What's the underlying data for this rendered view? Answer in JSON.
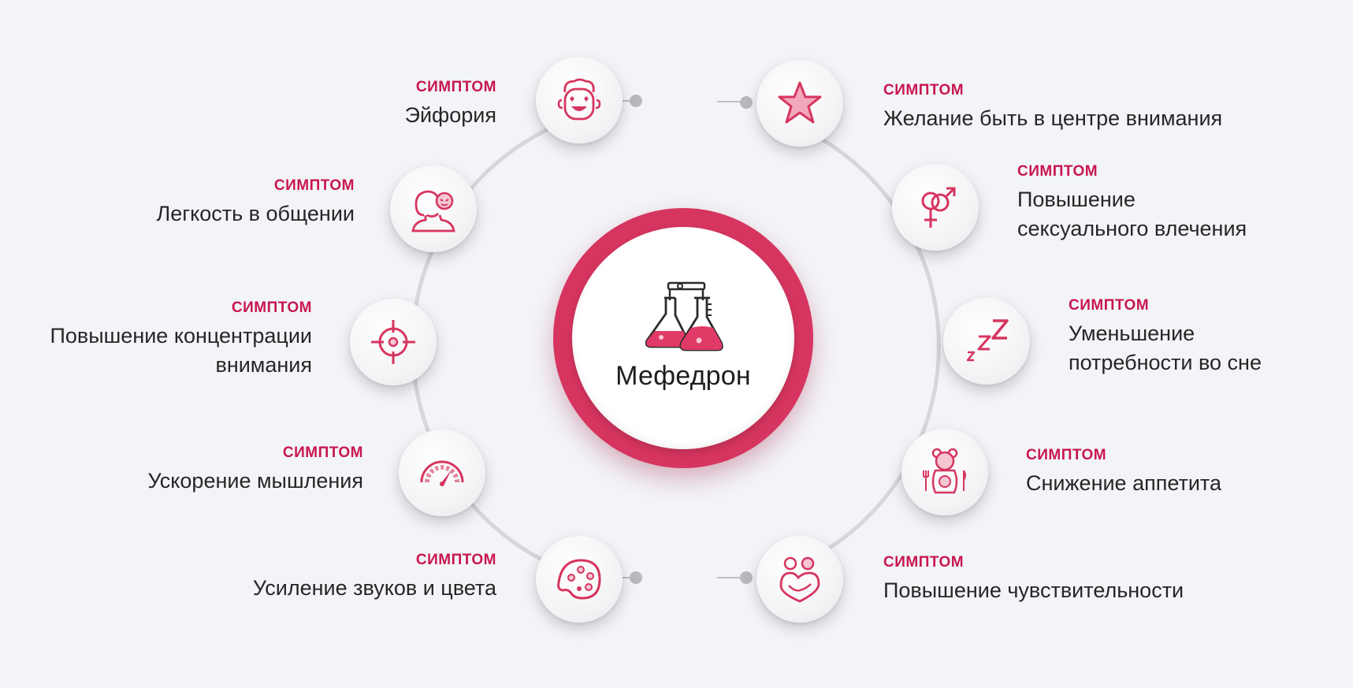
{
  "colors": {
    "accent": "#d6355f",
    "tag": "#c8174f",
    "ring": "#d6d6db",
    "text": "#262626",
    "background": "#f3f4f8"
  },
  "center": {
    "title": "Мефедрон",
    "icon": "flasks-icon"
  },
  "symptoms": [
    {
      "tag": "СИМПТОМ",
      "text": "Эйфория",
      "icon": "happy-face-icon"
    },
    {
      "tag": "СИМПТОМ",
      "text": "Легкость в общении",
      "icon": "person-chat-icon"
    },
    {
      "tag": "СИМПТОМ",
      "text": "Повышение концентрации внимания",
      "icon": "crosshair-icon"
    },
    {
      "tag": "СИМПТОМ",
      "text": "Ускорение мышления",
      "icon": "speedometer-icon"
    },
    {
      "tag": "СИМПТОМ",
      "text": "Усиление звуков и цвета",
      "icon": "palette-icon"
    },
    {
      "tag": "СИМПТОМ",
      "text": "Желание быть в центре внимания",
      "icon": "star-icon"
    },
    {
      "tag": "СИМПТОМ",
      "text": "Повышение сексуального влечения",
      "icon": "gender-icon"
    },
    {
      "tag": "СИМПТОМ",
      "text": "Уменьшение потребности во сне",
      "icon": "sleep-zzz-icon"
    },
    {
      "tag": "СИМПТОМ",
      "text": "Снижение аппетита",
      "icon": "teddy-bear-icon"
    },
    {
      "tag": "СИМПТОМ",
      "text": "Повышение чувствительности",
      "icon": "hugging-hearts-icon"
    }
  ]
}
